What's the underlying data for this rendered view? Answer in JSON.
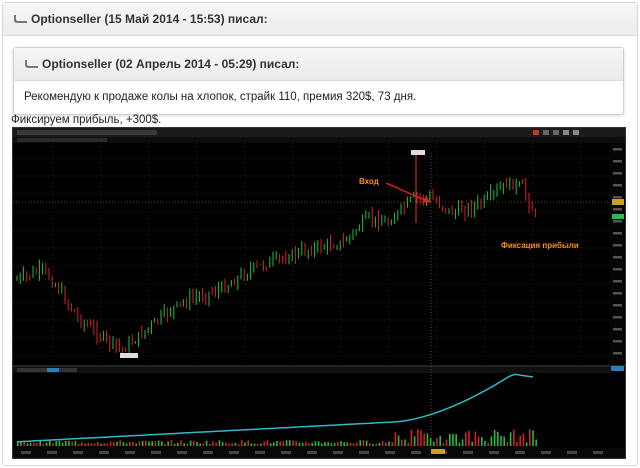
{
  "outer_quote": {
    "header": "Optionseller (15 Май 2014 - 15:53) писал:"
  },
  "inner_quote": {
    "header": "Optionseller (02 Апрель 2014 - 05:29) писал:",
    "body": "Рекомендую к продаже колы на хлопок, страйк 110, премия 320$, 73 дня."
  },
  "reply_text": "Фиксируем прибыль, +300$.",
  "chart": {
    "annotation_entry": "Вход",
    "annotation_exit": "Фиксация прибыли"
  },
  "icons": [
    "quote-icon"
  ],
  "colors": {
    "up": "#1fbf3a",
    "down": "#d32222",
    "annotation": "#ff8c1a",
    "arrow": "#e02020",
    "volume_line": "#2fb8c8"
  }
}
